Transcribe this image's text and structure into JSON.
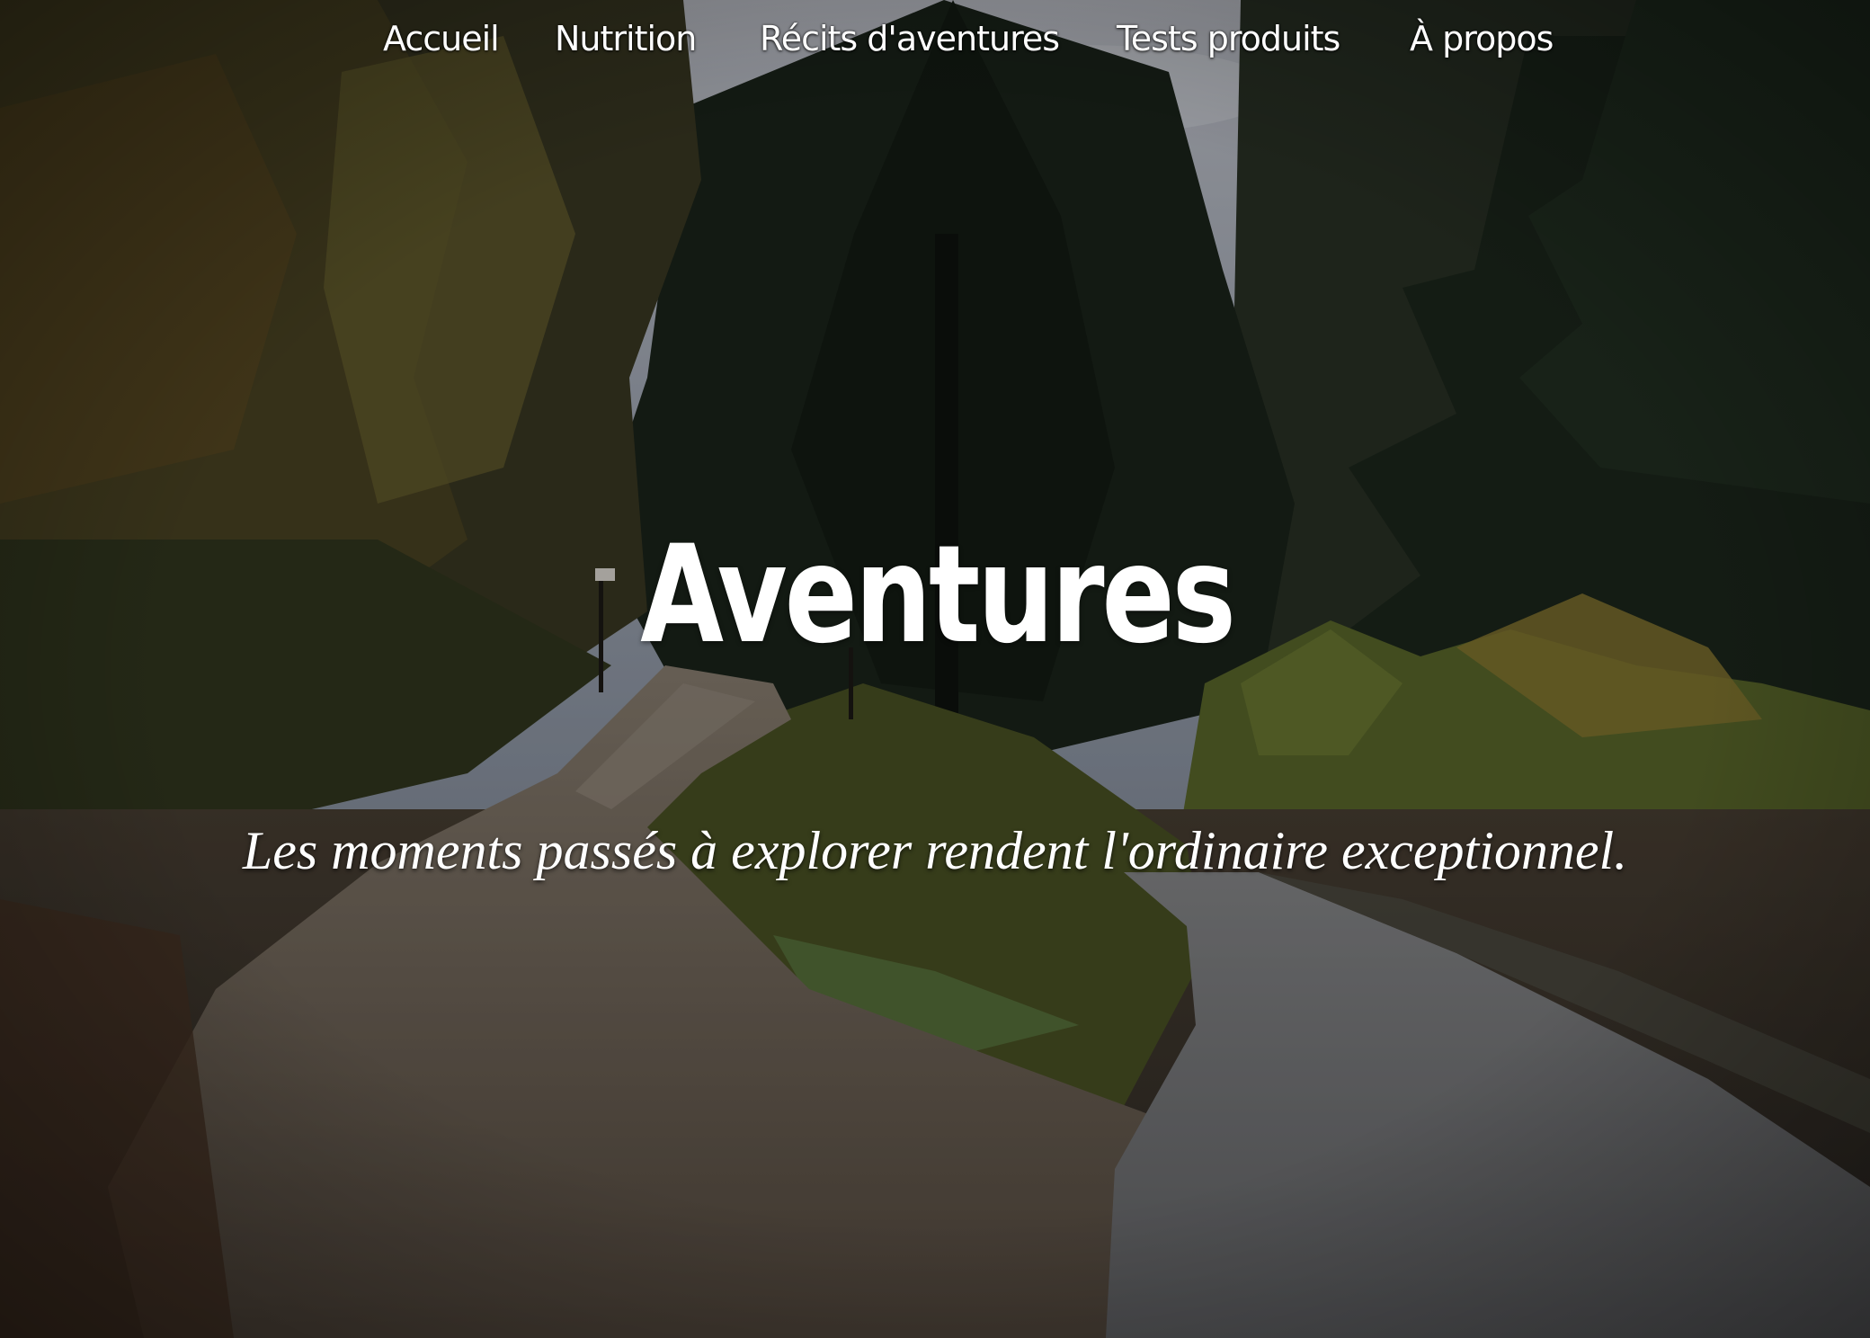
{
  "nav": {
    "items": [
      {
        "label": "Accueil"
      },
      {
        "label": "Nutrition"
      },
      {
        "label": "Récits d'aventures"
      },
      {
        "label": "Tests produits"
      },
      {
        "label": "À propos"
      }
    ]
  },
  "hero": {
    "title": "Aventures",
    "subtitle": "Les moments passés à explorer rendent l'ordinaire exceptionnel.",
    "background_description_icon": "forest-road-photo",
    "colors": {
      "text": "#ffffff",
      "sky": "#b9bfca",
      "dark_foliage": "#1f2a1f",
      "autumn_foliage": "#7a6a2f",
      "road": "#6f7072"
    }
  }
}
